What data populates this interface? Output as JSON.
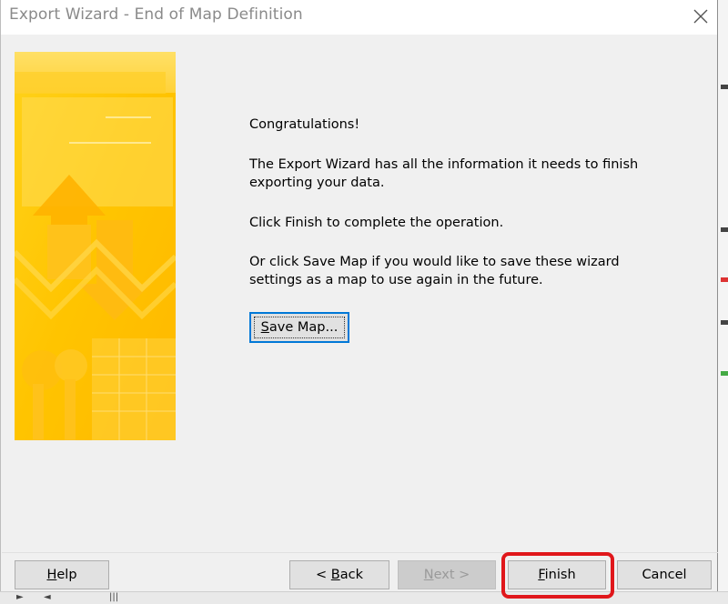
{
  "window": {
    "title": "Export Wizard - End of Map Definition",
    "close_icon": "close-icon"
  },
  "message": {
    "heading": "Congratulations!",
    "info": "The Export Wizard has all the information it needs to finish exporting your data.",
    "instruction": "Click Finish to complete the operation.",
    "save_hint": "Or click Save Map if you would like to save these wizard settings as a map to use again in the future."
  },
  "buttons": {
    "save_map": {
      "accel": "S",
      "rest": "ave Map..."
    },
    "help": {
      "accel": "H",
      "rest": "elp"
    },
    "back": {
      "prefix": "< ",
      "accel": "B",
      "rest": "ack"
    },
    "next": {
      "accel": "N",
      "rest": "ext >"
    },
    "finish": {
      "accel": "F",
      "rest": "inish"
    },
    "cancel": "Cancel"
  },
  "state": {
    "next_enabled": false,
    "highlighted": "finish"
  },
  "colors": {
    "accent": "#0078d7",
    "highlight": "#e0171b",
    "banner": "#ffcc00"
  }
}
